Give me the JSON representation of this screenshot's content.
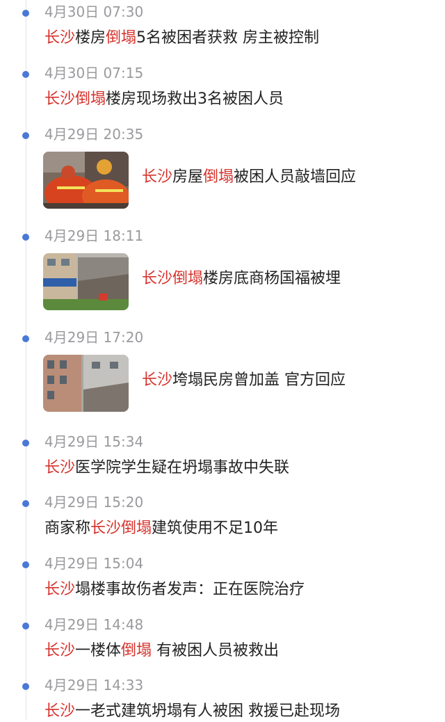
{
  "colors": {
    "dot": "#4a78d6",
    "highlight": "#d6322c",
    "time": "#9a9a9e",
    "text": "#222222"
  },
  "items": [
    {
      "time": "4月30日 07:30",
      "title": [
        {
          "t": "长沙",
          "hl": true
        },
        {
          "t": "楼房",
          "hl": false
        },
        {
          "t": "倒塌",
          "hl": true
        },
        {
          "t": "5名被困者获救 房主被控制",
          "hl": false
        }
      ]
    },
    {
      "time": "4月30日 07:15",
      "title": [
        {
          "t": "长沙倒塌",
          "hl": true
        },
        {
          "t": "楼房现场救出3名被困人员",
          "hl": false
        }
      ]
    },
    {
      "time": "4月29日 20:35",
      "thumb": "firefighters-rescue-photo",
      "title": [
        {
          "t": "长沙",
          "hl": true
        },
        {
          "t": "房屋",
          "hl": false
        },
        {
          "t": "倒塌",
          "hl": true
        },
        {
          "t": "被困人员敲墙回应",
          "hl": false
        }
      ]
    },
    {
      "time": "4月29日 18:11",
      "thumb": "collapsed-building-street-photo",
      "title": [
        {
          "t": "长沙倒塌",
          "hl": true
        },
        {
          "t": "楼房底商杨国福被埋",
          "hl": false
        }
      ]
    },
    {
      "time": "4月29日 17:20",
      "thumb": "collapsed-building-aerial-photo",
      "title": [
        {
          "t": "长沙",
          "hl": true
        },
        {
          "t": "垮塌民房曾加盖 官方回应",
          "hl": false
        }
      ]
    },
    {
      "time": "4月29日 15:34",
      "title": [
        {
          "t": "长沙",
          "hl": true
        },
        {
          "t": "医学院学生疑在坍塌事故中失联",
          "hl": false
        }
      ]
    },
    {
      "time": "4月29日 15:20",
      "title": [
        {
          "t": "商家称",
          "hl": false
        },
        {
          "t": "长沙倒塌",
          "hl": true
        },
        {
          "t": "建筑使用不足10年",
          "hl": false
        }
      ]
    },
    {
      "time": "4月29日 15:04",
      "title": [
        {
          "t": "长沙",
          "hl": true
        },
        {
          "t": "塌楼事故伤者发声：正在医院治疗",
          "hl": false
        }
      ]
    },
    {
      "time": "4月29日 14:48",
      "title": [
        {
          "t": "长沙",
          "hl": true
        },
        {
          "t": "一楼体",
          "hl": false
        },
        {
          "t": "倒塌",
          "hl": true
        },
        {
          "t": " 有被困人员被救出",
          "hl": false
        }
      ]
    },
    {
      "time": "4月29日 14:33",
      "title": [
        {
          "t": "长沙",
          "hl": true
        },
        {
          "t": "一老式建筑坍塌有人被困 救援已赴现场",
          "hl": false
        }
      ]
    }
  ]
}
